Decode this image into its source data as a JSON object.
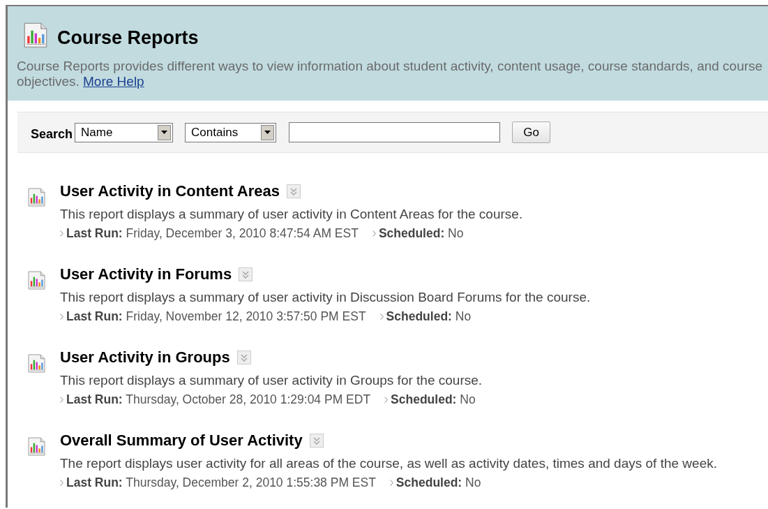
{
  "header": {
    "title": "Course Reports",
    "description": "Course Reports provides different ways to view information about student activity, content usage, course standards, and course objectives.",
    "help_link": "More Help"
  },
  "search": {
    "label": "Search",
    "field_select": "Name",
    "operator_select": "Contains",
    "button": "Go"
  },
  "reports": [
    {
      "title": "User Activity in Content Areas",
      "description": "This report displays a summary of user activity in Content Areas for the course.",
      "last_run_label": "Last Run:",
      "last_run": "Friday, December 3, 2010 8:47:54 AM EST",
      "scheduled_label": "Scheduled:",
      "scheduled": "No"
    },
    {
      "title": "User Activity in Forums",
      "description": "This report displays a summary of user activity in Discussion Board Forums for the course.",
      "last_run_label": "Last Run:",
      "last_run": "Friday, November 12, 2010 3:57:50 PM EST",
      "scheduled_label": "Scheduled:",
      "scheduled": "No"
    },
    {
      "title": "User Activity in Groups",
      "description": "This report displays a summary of user activity in Groups for the course.",
      "last_run_label": "Last Run:",
      "last_run": "Thursday, October 28, 2010 1:29:04 PM EDT",
      "scheduled_label": "Scheduled:",
      "scheduled": "No"
    },
    {
      "title": "Overall Summary of User Activity",
      "description": "The report displays user activity for all areas of the course, as well as activity dates, times and days of the week.",
      "last_run_label": "Last Run:",
      "last_run": "Thursday, December 2, 2010 1:55:38 PM EST",
      "scheduled_label": "Scheduled:",
      "scheduled": "No"
    }
  ]
}
